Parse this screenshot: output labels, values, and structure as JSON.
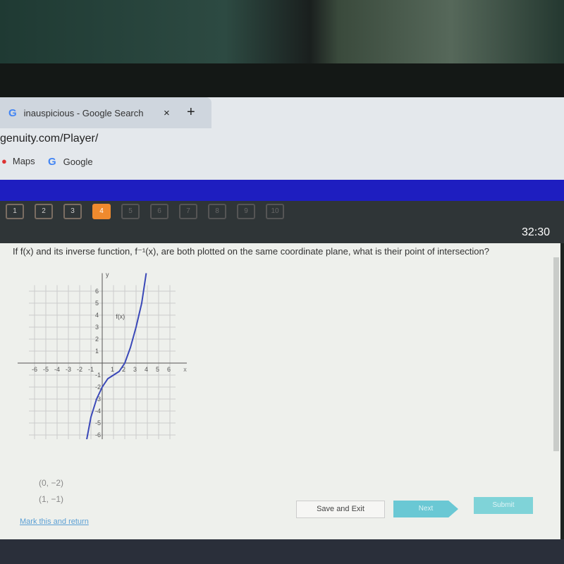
{
  "browser": {
    "tab_title": "inauspicious - Google Search",
    "tab_close": "×",
    "new_tab": "+",
    "url": "genuity.com/Player/",
    "bookmarks": [
      {
        "label": "Maps",
        "icon": "map-pin-icon"
      },
      {
        "label": "Google",
        "icon": "google-icon"
      }
    ]
  },
  "nav": {
    "questions": [
      "1",
      "2",
      "3",
      "4",
      "5",
      "6",
      "7",
      "8",
      "9",
      "10"
    ],
    "current": "4",
    "timer": "32:30"
  },
  "question": {
    "text": "If f(x) and its inverse function, f⁻¹(x), are both plotted on the same coordinate plane, what is their point of intersection?"
  },
  "chart_data": {
    "type": "line",
    "xlabel": "x",
    "ylabel": "y",
    "xlim": [
      -6,
      6
    ],
    "ylim": [
      -6,
      6
    ],
    "grid": true,
    "xticks": [
      "-6",
      "-5",
      "-4",
      "-3",
      "-2",
      "-1",
      "1",
      "2",
      "3",
      "4",
      "5",
      "6"
    ],
    "yticks": [
      "6",
      "5",
      "4",
      "3",
      "2",
      "1",
      "-1",
      "-2",
      "-3",
      "-4",
      "-5",
      "-6"
    ],
    "series": [
      {
        "name": "f(x)",
        "color": "#3a48b8",
        "points": [
          [
            -1.5,
            -7
          ],
          [
            -1,
            -4.5
          ],
          [
            -0.5,
            -3
          ],
          [
            0,
            -2
          ],
          [
            0.5,
            -1.3
          ],
          [
            1,
            -1
          ],
          [
            1.5,
            -0.7
          ],
          [
            2,
            0
          ],
          [
            2.5,
            1.3
          ],
          [
            3,
            3
          ],
          [
            3.5,
            5
          ],
          [
            3.9,
            7.5
          ]
        ]
      }
    ]
  },
  "answers": [
    "(0, −2)",
    "(1, −1)"
  ],
  "footer": {
    "mark": "Mark this and return",
    "save": "Save and Exit",
    "next": "Next",
    "submit": "Submit"
  },
  "colors": {
    "accent": "#ef8a2e",
    "banner": "#1e1ec0",
    "button": "#6ac8d4"
  }
}
